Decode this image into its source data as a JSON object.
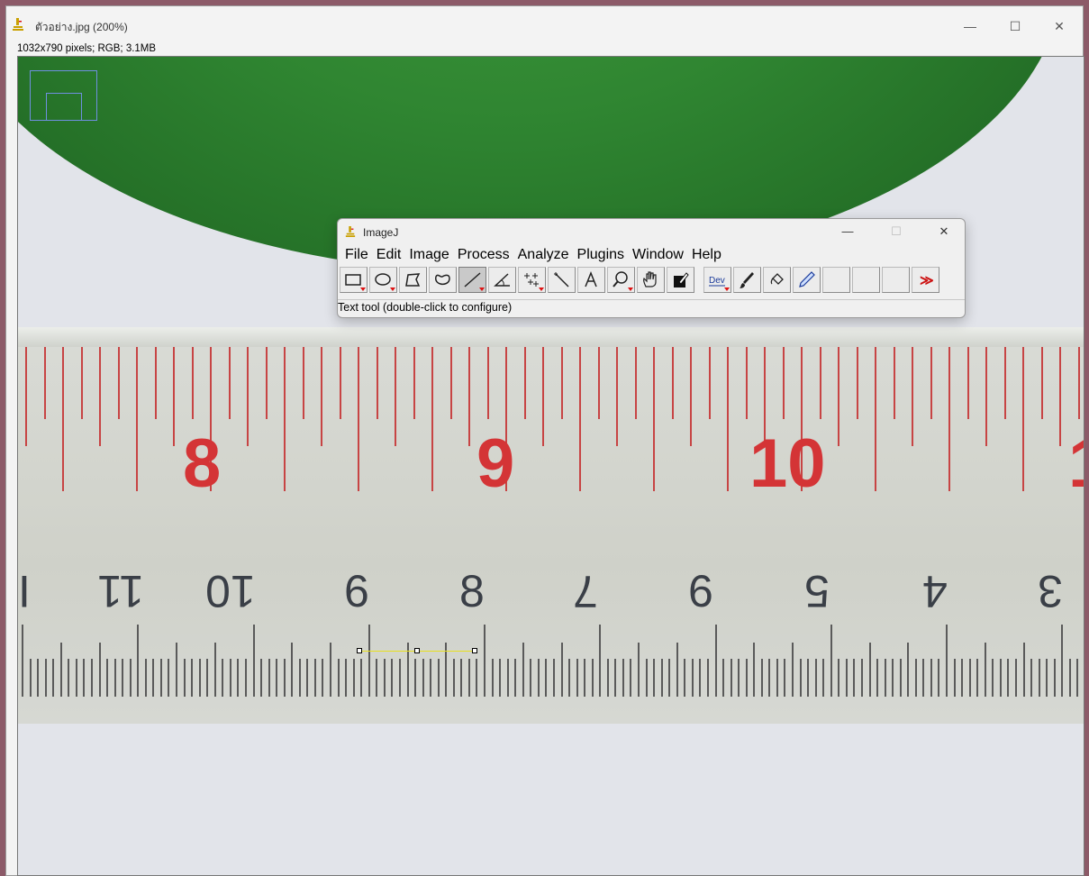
{
  "image_window": {
    "title": "ตัวอย่าง.jpg (200%)",
    "info": "1032x790 pixels; RGB; 3.1MB",
    "minimize_glyph": "—",
    "maximize_glyph": "☐",
    "close_glyph": "✕"
  },
  "ruler": {
    "top_numbers": [
      "8",
      "9",
      "10",
      "1"
    ],
    "bottom_numbers": [
      "I",
      "11",
      "10",
      "6",
      "8",
      "7",
      "6",
      "5",
      "4",
      "3"
    ]
  },
  "imagej": {
    "title": "ImageJ",
    "minimize_glyph": "—",
    "maximize_glyph": "☐",
    "close_glyph": "✕",
    "menu": [
      "File",
      "Edit",
      "Image",
      "Process",
      "Analyze",
      "Plugins",
      "Window",
      "Help"
    ],
    "tools": [
      {
        "icon": "rectangle-icon"
      },
      {
        "icon": "oval-icon"
      },
      {
        "icon": "polygon-icon"
      },
      {
        "icon": "freehand-icon"
      },
      {
        "icon": "straight-line-icon",
        "selected": true
      },
      {
        "icon": "angle-icon"
      },
      {
        "icon": "point-icon"
      },
      {
        "icon": "wand-icon"
      },
      {
        "icon": "text-icon"
      },
      {
        "icon": "magnifier-icon"
      },
      {
        "icon": "hand-icon"
      },
      {
        "icon": "color-picker-icon"
      },
      {
        "icon": "dev-icon",
        "label": "Dev"
      },
      {
        "icon": "brush-icon"
      },
      {
        "icon": "flood-fill-icon"
      },
      {
        "icon": "pencil-icon"
      },
      {
        "icon": "more-tools-icon",
        "label": "≫"
      }
    ],
    "status": "Text tool (double-click to configure)"
  },
  "colors": {
    "ruler_red": "#d43436",
    "leaf_green": "#2f8531",
    "line_yellow": "#e8e020"
  }
}
